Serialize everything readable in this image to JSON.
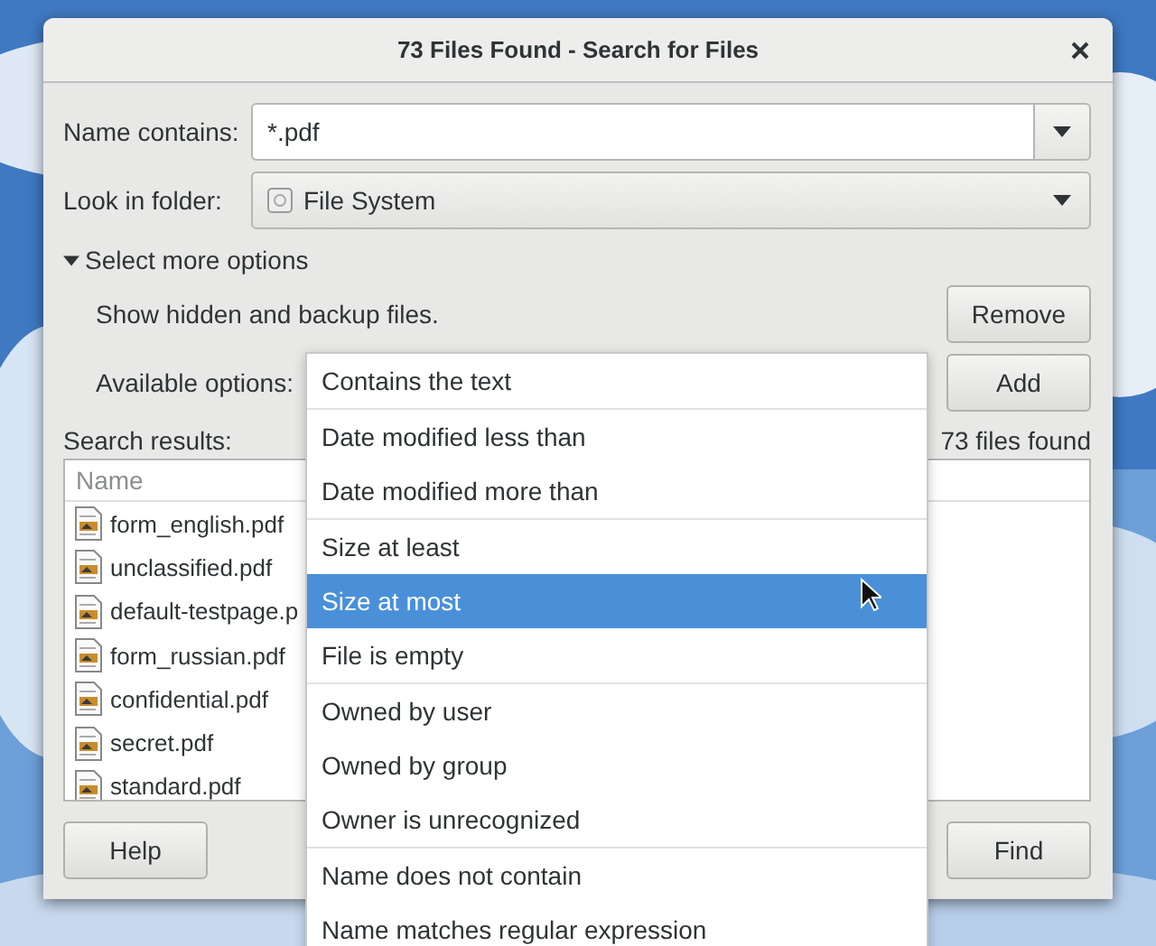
{
  "window": {
    "title": "73 Files Found - Search for Files"
  },
  "name_contains": {
    "label": "Name contains:",
    "value": "*.pdf"
  },
  "look_in": {
    "label": "Look in folder:",
    "value": "File System"
  },
  "more_options": {
    "label": "Select more options",
    "expanded": true
  },
  "option_rows": [
    {
      "text": "Show hidden and backup files.",
      "button": "Remove"
    },
    {
      "text": "Available options:",
      "button": "Add"
    }
  ],
  "results": {
    "label": "Search results:",
    "count": "73 files found",
    "column": "Name",
    "files": [
      "form_english.pdf",
      "unclassified.pdf",
      "default-testpage.p",
      "form_russian.pdf",
      "confidential.pdf",
      "secret.pdf",
      "standard.pdf"
    ]
  },
  "buttons": [
    {
      "label": "Help"
    },
    {
      "label": "Find"
    }
  ],
  "menu": {
    "groups": [
      [
        {
          "label": "Contains the text",
          "selected": false
        }
      ],
      [
        {
          "label": "Date modified less than",
          "selected": false
        },
        {
          "label": "Date modified more than",
          "selected": false
        }
      ],
      [
        {
          "label": "Size at least",
          "selected": false
        },
        {
          "label": "Size at most",
          "selected": true
        },
        {
          "label": "File is empty",
          "selected": false
        }
      ],
      [
        {
          "label": "Owned by user",
          "selected": false
        },
        {
          "label": "Owned by group",
          "selected": false
        },
        {
          "label": "Owner is unrecognized",
          "selected": false
        }
      ],
      [
        {
          "label": "Name does not contain",
          "selected": false
        },
        {
          "label": "Name matches regular expression",
          "selected": false
        }
      ]
    ]
  }
}
